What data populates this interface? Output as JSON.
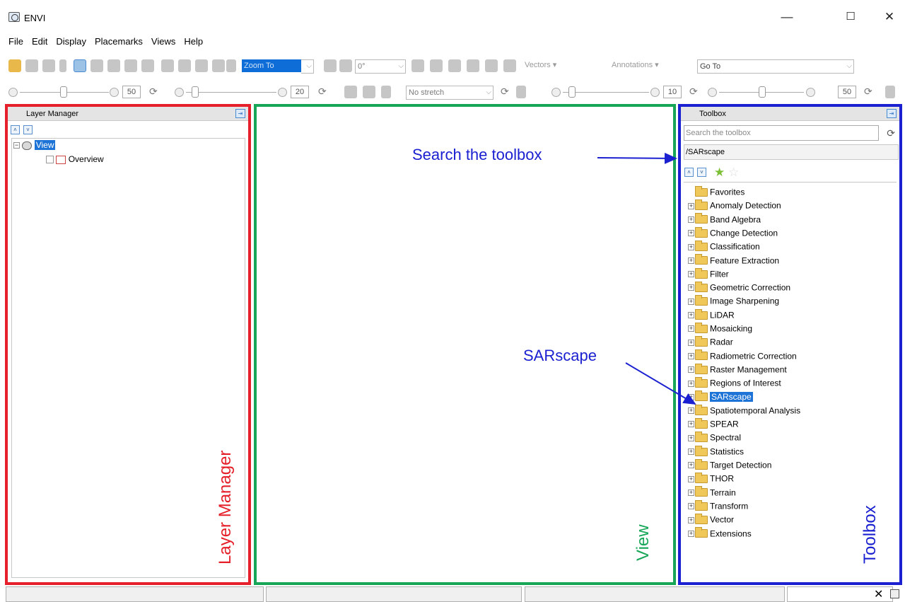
{
  "window": {
    "title": "ENVI",
    "minimize_glyph": "—",
    "maximize_glyph": "☐",
    "close_glyph": "✕"
  },
  "menu": [
    "File",
    "Edit",
    "Display",
    "Placemarks",
    "Views",
    "Help"
  ],
  "toolbar": {
    "zoom_combo": "Zoom To",
    "rotation_combo": "0°",
    "vectors_label": "Vectors ▾",
    "annotations_label": "Annotations ▾",
    "goto_placeholder": "Go To"
  },
  "adjust_bar": {
    "brightness_value": "50",
    "contrast_value": "20",
    "stretch_combo": "No stretch",
    "sharpen_value": "10",
    "transparency_value": "50"
  },
  "layer_manager": {
    "header": "Layer Manager",
    "tree": [
      {
        "label": "View",
        "selected": true
      },
      {
        "label": "Overview",
        "selected": false
      }
    ]
  },
  "toolbox": {
    "header": "Toolbox",
    "search_placeholder": "Search the toolbox",
    "path_text": "/SARscape",
    "items": [
      "Favorites",
      "Anomaly Detection",
      "Band Algebra",
      "Change Detection",
      "Classification",
      "Feature Extraction",
      "Filter",
      "Geometric Correction",
      "Image Sharpening",
      "LiDAR",
      "Mosaicking",
      "Radar",
      "Radiometric Correction",
      "Raster Management",
      "Regions of Interest",
      "SARscape",
      "Spatiotemporal Analysis",
      "SPEAR",
      "Spectral",
      "Statistics",
      "Target Detection",
      "THOR",
      "Terrain",
      "Transform",
      "Vector",
      "Extensions"
    ],
    "selected_item": "SARscape"
  },
  "annotations": {
    "layer_manager_label": "Layer Manager",
    "view_label": "View",
    "toolbox_label": "Toolbox",
    "search_callout": "Search the toolbox",
    "sarscape_callout": "SARscape",
    "layer_manager_color": "#e5202a",
    "view_color": "#17a657",
    "toolbox_color": "#1b21d0"
  },
  "statusbar": {
    "close_glyph": "✕"
  }
}
